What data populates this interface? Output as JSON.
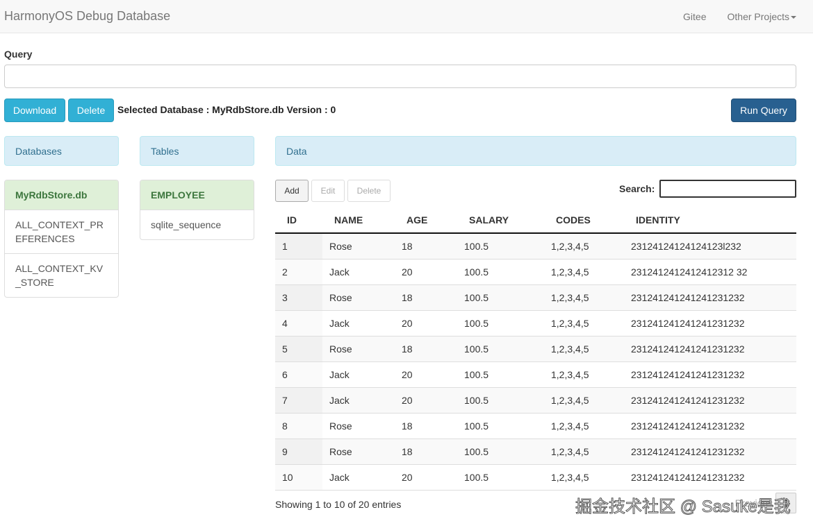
{
  "navbar": {
    "title": "HarmonyOS Debug Database",
    "links": [
      "Gitee",
      "Other Projects"
    ]
  },
  "query": {
    "label": "Query",
    "value": "",
    "placeholder": ""
  },
  "buttons": {
    "download": "Download",
    "delete": "Delete",
    "run": "Run Query"
  },
  "selected": "Selected Database : MyRdbStore.db Version : 0",
  "panels": {
    "databases": "Databases",
    "tables": "Tables",
    "data": "Data"
  },
  "databases": [
    "MyRdbStore.db",
    "ALL_CONTEXT_PREFERENCES",
    "ALL_CONTEXT_KV_STORE"
  ],
  "tables": [
    "EMPLOYEE",
    "sqlite_sequence"
  ],
  "toolbar": {
    "add": "Add",
    "edit": "Edit",
    "delete": "Delete",
    "search_label": "Search:",
    "search_value": ""
  },
  "columns": [
    "ID",
    "NAME",
    "AGE",
    "SALARY",
    "CODES",
    "IDENTITY"
  ],
  "rows": [
    [
      "1",
      "Rose",
      "18",
      "100.5",
      "1,2,3,4,5",
      "23124124124124123l232"
    ],
    [
      "2",
      "Jack",
      "20",
      "100.5",
      "1,2,3,4,5",
      "2312412412412412312 32"
    ],
    [
      "3",
      "Rose",
      "18",
      "100.5",
      "1,2,3,4,5",
      "231241241241241231232"
    ],
    [
      "4",
      "Jack",
      "20",
      "100.5",
      "1,2,3,4,5",
      "231241241241241231232"
    ],
    [
      "5",
      "Rose",
      "18",
      "100.5",
      "1,2,3,4,5",
      "231241241241241231232"
    ],
    [
      "6",
      "Jack",
      "20",
      "100.5",
      "1,2,3,4,5",
      "231241241241241231232"
    ],
    [
      "7",
      "Jack",
      "20",
      "100.5",
      "1,2,3,4,5",
      "231241241241241231232"
    ],
    [
      "8",
      "Rose",
      "18",
      "100.5",
      "1,2,3,4,5",
      "231241241241241231232"
    ],
    [
      "9",
      "Rose",
      "18",
      "100.5",
      "1,2,3,4,5",
      "231241241241241231232"
    ],
    [
      "10",
      "Jack",
      "20",
      "100.5",
      "1,2,3,4,5",
      "231241241241241231232"
    ]
  ],
  "footer": {
    "info": "Showing 1 to 10 of 20 entries",
    "previous": "Previous",
    "page": "1"
  },
  "watermark": "掘金技术社区 @ Sasuke是我"
}
